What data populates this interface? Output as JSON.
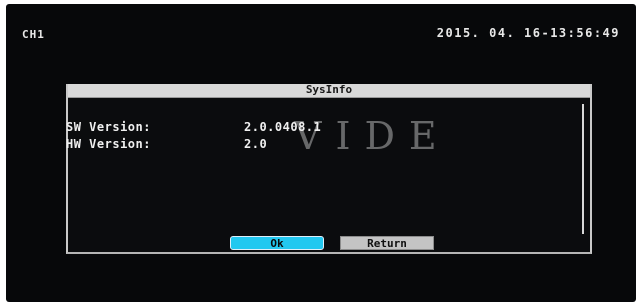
{
  "osd": {
    "channel": "CH1",
    "datetime": "2015. 04. 16-13:56:49"
  },
  "dialog": {
    "title": "SysInfo",
    "rows": [
      {
        "label": "SW Version:",
        "value": "2.0.0408.1"
      },
      {
        "label": "HW Version:",
        "value": "2.0"
      }
    ],
    "watermark": "VIDE",
    "ok_label": "Ok",
    "return_label": "Return"
  },
  "colors": {
    "screen_background": "#07080a",
    "title_bar": "#d9d9d9",
    "ok_button": "#22c8f0",
    "return_button": "#c4c4c4",
    "text": "#f0f0f0"
  }
}
